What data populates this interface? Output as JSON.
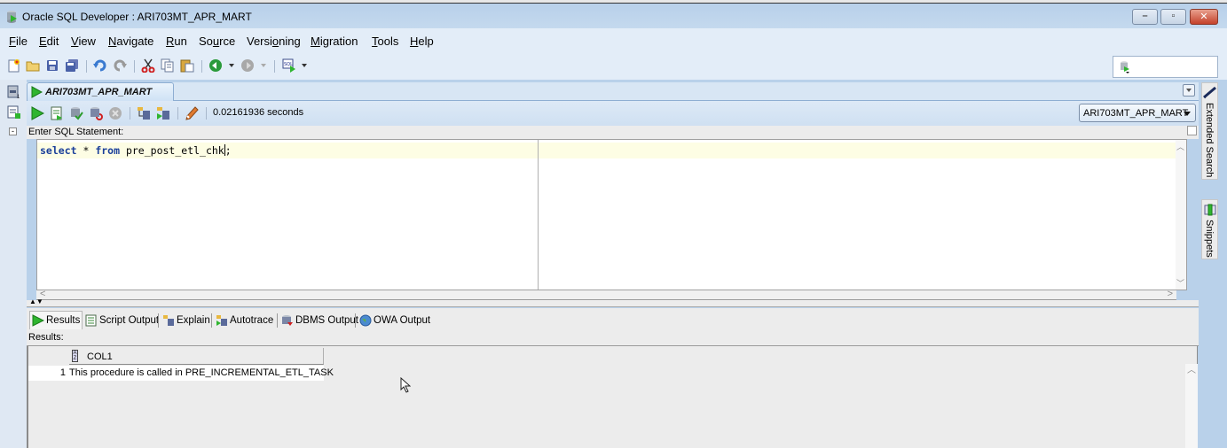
{
  "window": {
    "title": "Oracle SQL Developer : ARI703MT_APR_MART",
    "controls": {
      "minimize": "–",
      "maximize": "▫",
      "close": "✕"
    }
  },
  "menu": {
    "items": [
      {
        "label": "File",
        "mnemonic": "F",
        "rest": "ile"
      },
      {
        "label": "Edit",
        "mnemonic": "E",
        "rest": "dit"
      },
      {
        "label": "View",
        "mnemonic": "V",
        "rest": "iew"
      },
      {
        "label": "Navigate",
        "mnemonic": "N",
        "rest": "avigate"
      },
      {
        "label": "Run",
        "mnemonic": "R",
        "rest": "un"
      },
      {
        "label": "Source",
        "pre": "So",
        "mnemonic": "u",
        "rest": "rce"
      },
      {
        "label": "Versioning",
        "pre": "Versi",
        "mnemonic": "o",
        "rest": "ning"
      },
      {
        "label": "Migration",
        "mnemonic": "M",
        "rest": "igration"
      },
      {
        "label": "Tools",
        "mnemonic": "T",
        "rest": "ools"
      },
      {
        "label": "Help",
        "mnemonic": "H",
        "rest": "elp"
      }
    ]
  },
  "toolbar": {
    "icons": [
      "new-icon",
      "open-icon",
      "save-icon",
      "save-all-icon",
      "undo-icon",
      "redo-icon",
      "cut-icon",
      "copy-icon",
      "paste-icon",
      "back-icon",
      "forward-icon",
      "sql-worksheet-icon"
    ]
  },
  "document_tab": {
    "label": "ARI703MT_APR_MART"
  },
  "worksheet": {
    "elapsed": "0.02161936 seconds",
    "connection": "ARI703MT_APR_MART",
    "editor_label": "Enter SQL Statement:",
    "sql": {
      "kw1": "select",
      "mid": " * ",
      "kw2": "from",
      "rest": " pre_post_etl_chk",
      "after_caret": ";"
    }
  },
  "right_panels": [
    {
      "label": "Extended Search"
    },
    {
      "label": "Snippets"
    }
  ],
  "output_tabs": [
    {
      "label": "Results",
      "active": true
    },
    {
      "label": "Script Output"
    },
    {
      "label": "Explain"
    },
    {
      "label": "Autotrace"
    },
    {
      "label": "DBMS Output"
    },
    {
      "label": "OWA Output"
    }
  ],
  "results": {
    "label": "Results:",
    "columns": [
      "COL1"
    ],
    "rows": [
      {
        "num": "1",
        "cells": [
          "This procedure is called in PRE_INCREMENTAL_ETL_TASK"
        ]
      }
    ]
  },
  "colors": {
    "titlebar": "#b9d1ea",
    "menubar": "#e3edf8",
    "current_line": "#fdfde4",
    "keyword": "#1a3f9a",
    "close_button": "#c4422b"
  }
}
